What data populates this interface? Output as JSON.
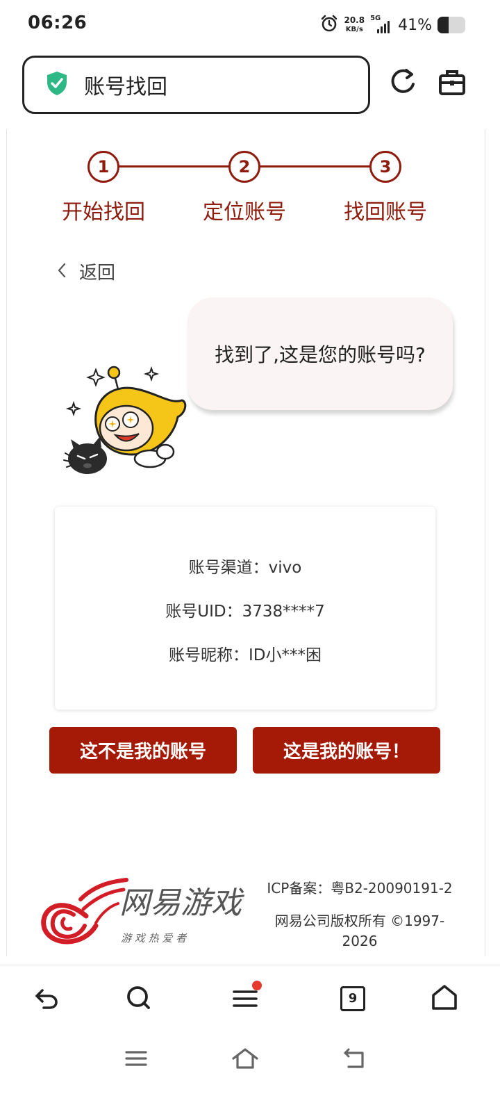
{
  "status_bar": {
    "time": "06:26",
    "net_speed_value": "20.8",
    "net_speed_unit": "KB/s",
    "network": "5G",
    "battery_percent": "41%",
    "battery_level": 0.41
  },
  "address_bar": {
    "page_title": "账号找回",
    "secure_icon": "shield-check-icon"
  },
  "toolbar": {
    "refresh_icon": "refresh-icon",
    "toolbox_icon": "toolbox-icon"
  },
  "stepper": {
    "steps": [
      {
        "number": "1",
        "label": "开始找回"
      },
      {
        "number": "2",
        "label": "定位账号"
      },
      {
        "number": "3",
        "label": "找回账号"
      }
    ],
    "accent_color": "#8e1b0c"
  },
  "back": {
    "label": "返回"
  },
  "bubble": {
    "text": "找到了,这是您的账号吗?"
  },
  "account": {
    "channel": "账号渠道：vivo",
    "uid": "账号UID：3738****7",
    "nickname": "账号昵称：ID小***困"
  },
  "buttons": {
    "not_mine": "这不是我的账号",
    "is_mine": "这是我的账号！",
    "color": "#a41a07"
  },
  "footer": {
    "logo_text": "网易游戏",
    "logo_slogan": "游 戏 热 爱 者",
    "icp": "ICP备案：粤B2-20090191-2",
    "copyright_line1": "网易公司版权所有 ©1997-",
    "copyright_line2": "2026"
  },
  "browser_nav": {
    "back_icon": "undo-arrow-icon",
    "search_icon": "search-icon",
    "menu_icon": "menu-icon",
    "menu_has_notification": true,
    "tabs_count": "9",
    "home_icon": "home-icon"
  },
  "system_nav": {
    "recents_icon": "recents-icon",
    "home_icon": "system-home-icon",
    "back_icon": "system-back-icon"
  }
}
